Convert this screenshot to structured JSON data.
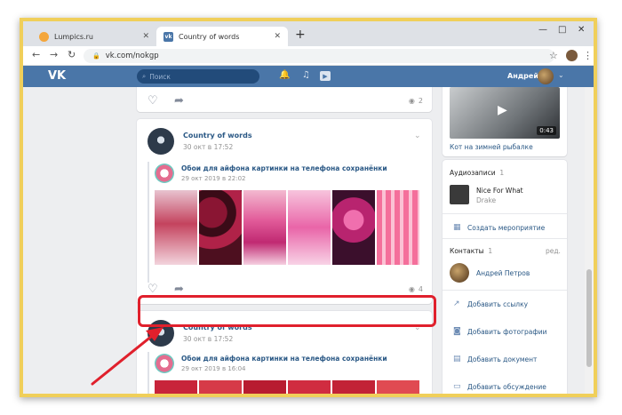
{
  "browser": {
    "tabs": [
      {
        "label": "Lumpics.ru",
        "active": false
      },
      {
        "label": "Country of words",
        "active": true
      }
    ],
    "new_tab": "+",
    "address": "vk.com/nokgp",
    "window_controls": [
      "—",
      "□",
      "✕"
    ]
  },
  "vk_header": {
    "logo": "VK",
    "search_placeholder": "Поиск",
    "user_name": "Андрей"
  },
  "feed": {
    "prev_post_views": "2",
    "posts": [
      {
        "group": "Country of words",
        "date": "30 окт в 17:52",
        "repost_title": "Обои для айфона картинки на телефона сохранёнки",
        "repost_date": "29 окт 2019 в 22:02",
        "views": "4"
      },
      {
        "group": "Country of words",
        "date": "30 окт в 17:52",
        "repost_title": "Обои для айфона картинки на телефона сохранёнки",
        "repost_date": "29 окт 2019 в 16:04"
      }
    ]
  },
  "sidebar": {
    "video_duration": "0:43",
    "video_title": "Кот на зимней рыбалке",
    "audio_header": "Аудиозаписи",
    "audio_count": "1",
    "track_title": "Nice For What",
    "track_artist": "Drake",
    "create_event": "Создать мероприятие",
    "contacts_header": "Контакты",
    "contacts_count": "1",
    "contacts_edit": "ред.",
    "contact_name": "Андрей Петров",
    "add_link": "Добавить ссылку",
    "add_photos": "Добавить фотографии",
    "add_document": "Добавить документ",
    "add_discussion": "Добавить обсуждение"
  },
  "colors": {
    "vk_blue": "#4a76a8",
    "highlight_red": "#e0202c",
    "frame_gold": "#f0cf5a"
  }
}
